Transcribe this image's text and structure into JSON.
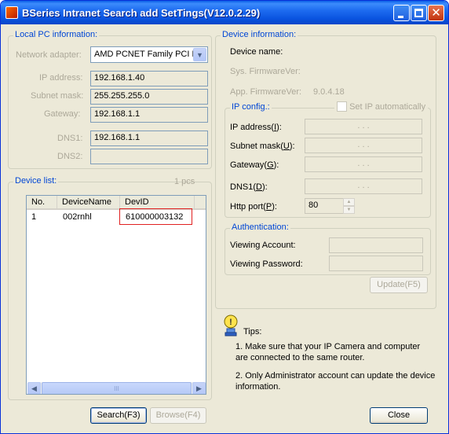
{
  "window": {
    "title": "BSeries Intranet Search add  SetTings(V12.0.2.29)",
    "close_glyph": "✕"
  },
  "local_pc": {
    "legend": "Local PC information:",
    "network_adapter_label": "Network adapter:",
    "network_adapter_value": "AMD PCNET Family PCI Eth",
    "ip_label": "IP address:",
    "ip_value": "192.168.1.40",
    "subnet_label": "Subnet mask:",
    "subnet_value": "255.255.255.0",
    "gateway_label": "Gateway:",
    "gateway_value": "192.168.1.1",
    "dns1_label": "DNS1:",
    "dns1_value": "192.168.1.1",
    "dns2_label": "DNS2:",
    "dns2_value": ""
  },
  "device_list": {
    "legend": "Device list:",
    "count": "1 pcs",
    "columns": [
      "No.",
      "DeviceName",
      "DevID"
    ],
    "rows": [
      {
        "no": "1",
        "name": "002rnhl",
        "devid": "610000003132"
      }
    ],
    "highlight_color": "#e02020",
    "scroll_thumb_glyph": "III"
  },
  "device_info": {
    "legend": "Device information:",
    "device_name_label": "Device name:",
    "sys_fw_label": "Sys. FirmwareVer:",
    "app_fw_label": "App. FirmwareVer:",
    "app_fw_value": "9.0.4.18"
  },
  "ip_config": {
    "legend": "IP config.:",
    "auto_label": "Set IP automatically",
    "ip_prefix": "IP address(",
    "ip_key": "I",
    "ip_suffix": "):",
    "subnet_prefix": "Subnet mask(",
    "subnet_key": "U",
    "subnet_suffix": "):",
    "gateway_prefix": "Gateway(",
    "gateway_key": "G",
    "gateway_suffix": "):",
    "dns1_prefix": "DNS1(",
    "dns1_key": "D",
    "dns1_suffix": "):",
    "http_prefix": "Http port(",
    "http_key": "P",
    "http_suffix": "):",
    "http_value": "80",
    "ip_placeholder": ".          .          ."
  },
  "authentication": {
    "legend": "Authentication:",
    "account_label": "Viewing Account:",
    "password_label": "Viewing Password:"
  },
  "buttons": {
    "update": "Update(F5)",
    "search": "Search(F3)",
    "browse": "Browse(F4)",
    "close": "Close"
  },
  "tips": {
    "title": "Tips:",
    "line1": "1. Make sure  that your IP Camera and computer",
    "line2": "are connected to the same router.",
    "line3": "2. Only Administrator account can update the device",
    "line4": "information."
  },
  "colors": {
    "title_bar": "#0a54e0",
    "legend_text": "#0046d5",
    "window_bg": "#ece9d8"
  }
}
